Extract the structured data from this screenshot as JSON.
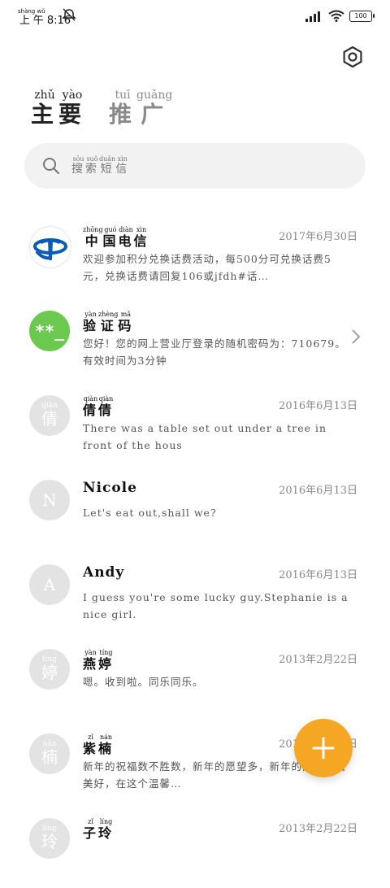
{
  "status_bar": {
    "time_prefix": "上午",
    "time_prefix_pinyin": "shàng wǔ",
    "time": "8:16",
    "battery": "100"
  },
  "tabs": [
    {
      "label": "主要",
      "pinyin": [
        "zhǔ",
        "yào"
      ],
      "active": true
    },
    {
      "label": "推广",
      "pinyin": [
        "tuī",
        "guǎng"
      ],
      "active": false
    }
  ],
  "search": {
    "placeholder": "搜索短信",
    "pinyin": [
      "sōu",
      "suǒ",
      "duǎn",
      "xìn"
    ]
  },
  "messages": [
    {
      "name": "中国电信",
      "name_pinyin": [
        "zhōng",
        "guó",
        "diàn",
        "xìn"
      ],
      "date": "2017年6月30日",
      "preview": "欢迎参加积分兑换话费活动，每500分可兑换话费5元，兑换话费请回复106或jfdh#话…",
      "avatar": "telecom-logo"
    },
    {
      "name": "验证码",
      "name_pinyin": [
        "yàn",
        "zhèng",
        "mǎ"
      ],
      "date": "",
      "preview": "您好！您的网上营业厅登录的随机密码为：710679。有效时间为3分钟",
      "avatar": "**_"
    },
    {
      "name": "倩倩",
      "name_pinyin": [
        "qiàn",
        "qiàn"
      ],
      "date": "2016年6月13日",
      "preview": "There was a table set out under a tree in front of the hous",
      "avatar": "倩",
      "avatar_pinyin": "qiàn"
    },
    {
      "name": "Nicole",
      "date": "2016年6月13日",
      "preview": "Let's eat out,shall we?",
      "avatar": "N"
    },
    {
      "name": "Andy",
      "date": "2016年6月13日",
      "preview": "I guess you're some lucky guy.Stephanie is a nice girl.",
      "avatar": "A"
    },
    {
      "name": "燕婷",
      "name_pinyin": [
        "yàn",
        "tíng"
      ],
      "date": "2013年2月22日",
      "preview": "嗯。收到啦。同乐同乐。",
      "avatar": "婷",
      "avatar_pinyin": "tíng"
    },
    {
      "name": "紫楠",
      "name_pinyin": [
        "zǐ",
        "nán"
      ],
      "date": "2013年2月22日",
      "preview": "新年的祝福数不胜数，新年的愿望多，新年的问候依旧美好，在这个温馨…",
      "avatar": "楠",
      "avatar_pinyin": "nán"
    },
    {
      "name": "子玲",
      "name_pinyin": [
        "zǐ",
        "líng"
      ],
      "date": "2013年2月22日",
      "preview": "",
      "avatar": "玲",
      "avatar_pinyin": "líng"
    }
  ],
  "colors": {
    "fab": "#f5a623",
    "verify_avatar": "#6bc94f",
    "telecom_blue": "#0a5bb5"
  }
}
